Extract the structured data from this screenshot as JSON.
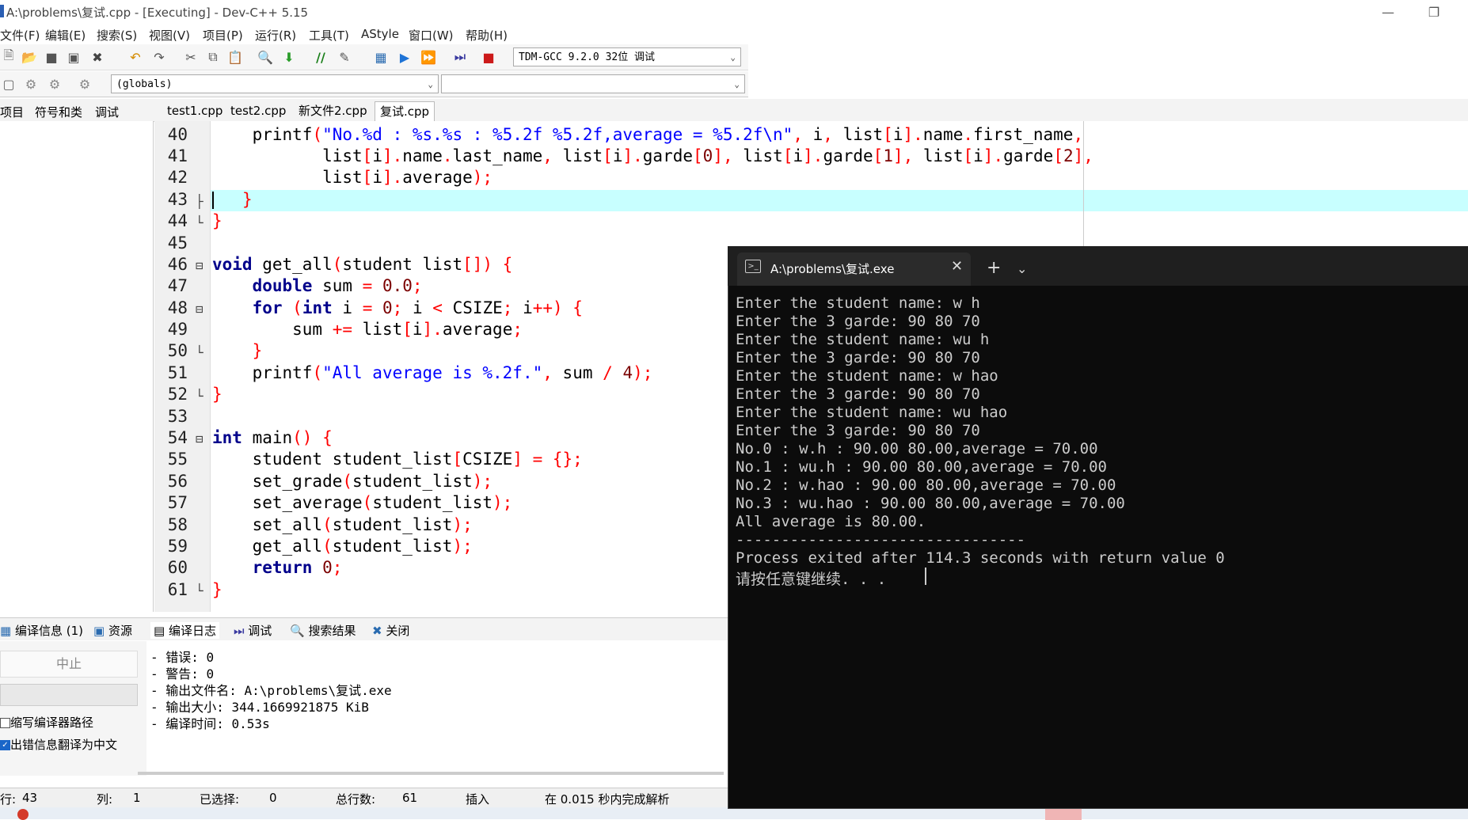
{
  "window": {
    "title": "A:\\problems\\复试.cpp - [Executing] - Dev-C++ 5.15"
  },
  "menu": [
    "文件(F)",
    "编辑(E)",
    "搜索(S)",
    "视图(V)",
    "项目(P)",
    "运行(R)",
    "工具(T)",
    "AStyle",
    "窗口(W)",
    "帮助(H)"
  ],
  "toolbar": {
    "compiler": "TDM-GCC 9.2.0 32位  调试",
    "scope": "(globals)"
  },
  "left_tabs": [
    "项目",
    "符号和类",
    "调试"
  ],
  "file_tabs": [
    "test1.cpp",
    "test2.cpp",
    "新文件2.cpp",
    "复试.cpp"
  ],
  "editor": {
    "line_numbers": [
      "40",
      "41",
      "42",
      "43",
      "44",
      "45",
      "46",
      "47",
      "48",
      "49",
      "50",
      "51",
      "52",
      "53",
      "54",
      "55",
      "56",
      "57",
      "58",
      "59",
      "60",
      "61"
    ],
    "highlight_line": "43"
  },
  "bottom_tabs": [
    "编译信息 (1)",
    "资源",
    "编译日志",
    "调试",
    "搜索结果",
    "关闭"
  ],
  "bottom_left": {
    "stop_button": "中止",
    "option1": "缩写编译器路径",
    "option2": "出错信息翻译为中文",
    "option1_checked": false,
    "option2_checked": true
  },
  "compile_log": [
    "- 错误: 0",
    "- 警告: 0",
    "- 输出文件名: A:\\problems\\复试.exe",
    "- 输出大小: 344.1669921875 KiB",
    "- 编译时间: 0.53s"
  ],
  "status": {
    "row_label": "行:",
    "row_value": "43",
    "col_label": "列:",
    "col_value": "1",
    "selected_label": "已选择:",
    "selected_value": "0",
    "total_label": "总行数:",
    "total_value": "61",
    "mode": "插入",
    "parse": "在 0.015 秒内完成解析"
  },
  "terminal": {
    "tab_title": "A:\\problems\\复试.exe",
    "lines": [
      "Enter the student name: w h",
      "Enter the 3 garde: 90 80 70",
      "Enter the student name: wu h",
      "Enter the 3 garde: 90 80 70",
      "Enter the student name: w hao",
      "Enter the 3 garde: 90 80 70",
      "Enter the student name: wu hao",
      "Enter the 3 garde: 90 80 70",
      "No.0 : w.h : 90.00 80.00,average = 70.00",
      "No.1 : wu.h : 90.00 80.00,average = 70.00",
      "No.2 : w.hao : 90.00 80.00,average = 70.00",
      "No.3 : wu.hao : 90.00 80.00,average = 70.00",
      "All average is 80.00.",
      "--------------------------------",
      "Process exited after 114.3 seconds with return value 0",
      "请按任意键继续. . ."
    ]
  }
}
